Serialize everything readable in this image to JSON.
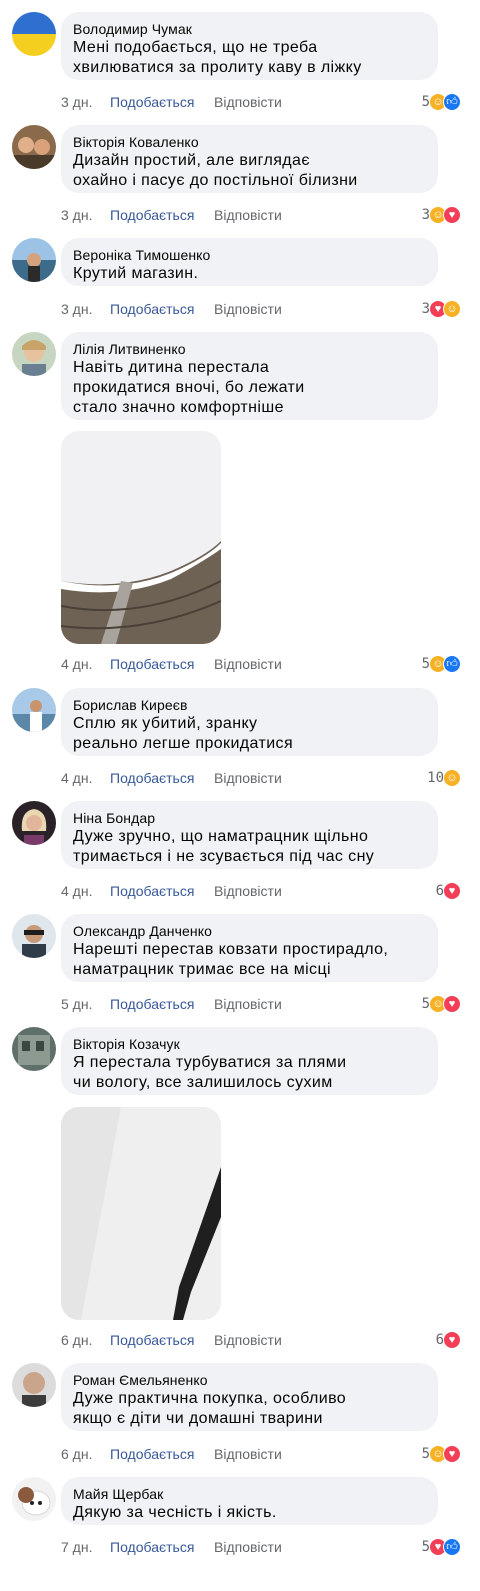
{
  "labels": {
    "like": "Подобається",
    "reply": "Відповісти"
  },
  "comments": [
    {
      "author": "Володимир Чумак",
      "text": "Мені подобається, що не треба\nхвилюватися за пролиту каву в ліжку",
      "time": "3 дн.",
      "count": "5",
      "reactions": [
        "care",
        "like"
      ]
    },
    {
      "author": "Вікторія Коваленко",
      "text": "Дизайн простий, але виглядає\nохайно і пасує до постільної білизни",
      "time": "3 дн.",
      "count": "3",
      "reactions": [
        "care",
        "love"
      ]
    },
    {
      "author": "Вероніка Тимошенко",
      "text": "Крутий магазин.",
      "time": "3 дн.",
      "count": "3",
      "reactions": [
        "love",
        "care"
      ]
    },
    {
      "author": "Лілія Литвиненко",
      "text": "Навіть дитина перестала\nпрокидатися вночі, бо лежати\nстало значно комфортніше",
      "time": "4 дн.",
      "count": "5",
      "reactions": [
        "care",
        "like"
      ]
    },
    {
      "author": "Борислав Киреєв",
      "text": "Сплю як убитий, зранку\nреально легше прокидатися",
      "time": "4 дн.",
      "count": "10",
      "reactions": [
        "care"
      ]
    },
    {
      "author": "Ніна Бондар",
      "text": "Дуже зручно, що наматрацник щільно\nтримається і не зсувається під час сну",
      "time": "4 дн.",
      "count": "6",
      "reactions": [
        "love"
      ]
    },
    {
      "author": "Олександр Данченко",
      "text": "Нарешті перестав ковзати простирадло,\nнаматрацник тримає все на місці",
      "time": "5 дн.",
      "count": "5",
      "reactions": [
        "care",
        "love"
      ]
    },
    {
      "author": "Вікторія Козачук",
      "text": "Я перестала турбуватися за плями\nчи вологу, все залишилось сухим",
      "time": "6 дн.",
      "count": "6",
      "reactions": [
        "love"
      ]
    },
    {
      "author": "Роман Ємельяненко",
      "text": "Дуже практична покупка, особливо\nякщо є діти чи домашні тварини",
      "time": "6 дн.",
      "count": "5",
      "reactions": [
        "care",
        "love"
      ]
    },
    {
      "author": "Майя Щербак",
      "text": "Дякую за чесність і якість.",
      "time": "7 дн.",
      "count": "5",
      "reactions": [
        "love",
        "like"
      ]
    }
  ]
}
